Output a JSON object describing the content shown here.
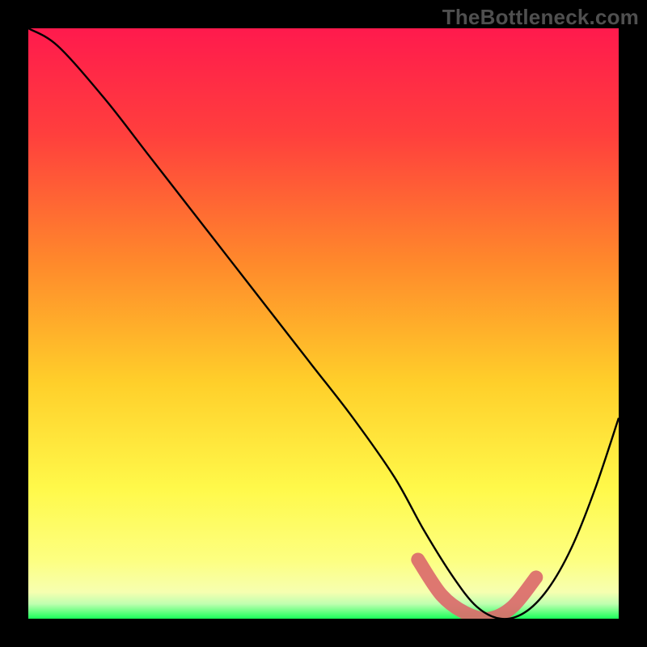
{
  "watermark": "TheBottleneck.com",
  "chart_data": {
    "type": "line",
    "title": "",
    "xlabel": "",
    "ylabel": "",
    "xlim": [
      0,
      100
    ],
    "ylim": [
      0,
      100
    ],
    "grid": false,
    "series": [
      {
        "name": "curve",
        "color": "#000000",
        "x": [
          0,
          5,
          13,
          20,
          27,
          34,
          41,
          48,
          55,
          62,
          67,
          72,
          76,
          80,
          84,
          88,
          92,
          96,
          100
        ],
        "y": [
          100,
          97,
          88,
          79,
          70,
          61,
          52,
          43,
          34,
          24,
          15,
          7,
          2,
          0,
          1,
          5,
          12,
          22,
          34
        ]
      }
    ],
    "highlight_band": {
      "color": "#db6b6b",
      "x": [
        66,
        70,
        74,
        78,
        82,
        86
      ],
      "y": [
        10,
        4,
        1,
        0,
        2,
        7
      ]
    },
    "gradient_stops": [
      {
        "offset": 0.0,
        "color": "#ff1a4d"
      },
      {
        "offset": 0.18,
        "color": "#ff3f3d"
      },
      {
        "offset": 0.4,
        "color": "#ff8a2b"
      },
      {
        "offset": 0.6,
        "color": "#ffcf2a"
      },
      {
        "offset": 0.78,
        "color": "#fff94a"
      },
      {
        "offset": 0.9,
        "color": "#fdff80"
      },
      {
        "offset": 0.955,
        "color": "#f6ffb0"
      },
      {
        "offset": 0.975,
        "color": "#bfffb0"
      },
      {
        "offset": 1.0,
        "color": "#1aff5a"
      }
    ]
  }
}
